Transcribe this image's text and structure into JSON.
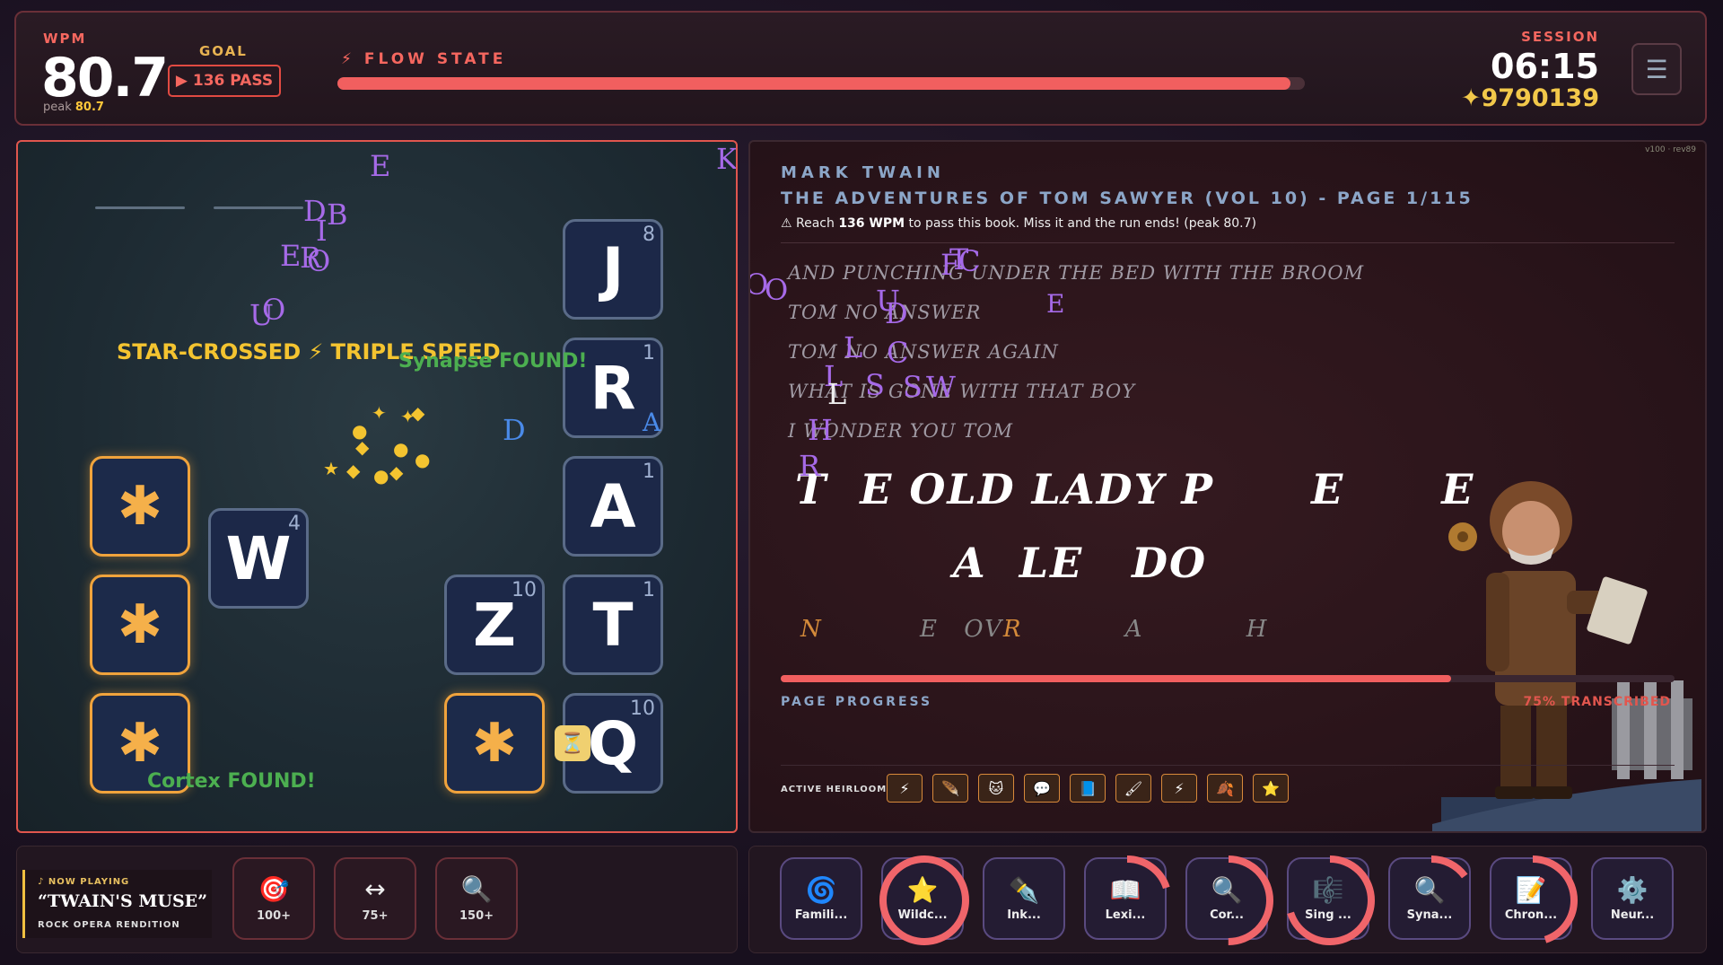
{
  "hud": {
    "wpm_label": "WPM",
    "wpm_value": "80.7",
    "peak_label": "peak",
    "peak_value": "80.7",
    "goal_label": "GOAL",
    "goal_button": "▶ 136 PASS",
    "flow_label": "⚡ FLOW STATE",
    "flow_progress": 0.985,
    "session_label": "SESSION",
    "session_time": "06:15",
    "score": "✦9790139",
    "menu_icon": "hamburger-menu-icon"
  },
  "board": {
    "tiles": [
      {
        "letter": "J",
        "score": "8",
        "gold": false
      },
      {
        "letter": "R",
        "score": "1",
        "gold": false
      },
      {
        "letter": "A",
        "score": "1",
        "gold": false
      },
      {
        "letter": "W",
        "score": "4",
        "gold": false
      },
      {
        "letter": "Z",
        "score": "10",
        "gold": false
      },
      {
        "letter": "T",
        "score": "1",
        "gold": false
      },
      {
        "letter": "Q",
        "score": "10",
        "gold": false
      },
      {
        "letter": "✱",
        "score": "",
        "gold": true
      },
      {
        "letter": "✱",
        "score": "",
        "gold": true
      },
      {
        "letter": "✱",
        "score": "",
        "gold": true
      },
      {
        "letter": "✱",
        "score": "",
        "gold": true
      }
    ],
    "combo_text": "STAR-CROSSED ⚡ TRIPLE SPEED",
    "found_1": "Synapse FOUND!",
    "found_2": "Cortex FOUND!",
    "floating_letters": [
      "E",
      "K",
      "D",
      "B",
      "I",
      "E",
      "R",
      "O",
      "U",
      "O",
      "D",
      "A"
    ]
  },
  "book": {
    "version": "v100 · rev89",
    "author": "MARK TWAIN",
    "title": "THE ADVENTURES OF TOM SAWYER (VOL 10) - PAGE 1/115",
    "warning_pre": "⚠ Reach ",
    "warning_wpm": "136 WPM",
    "warning_post": " to pass this book. Miss it and the run ends! (peak 80.7)",
    "lines": [
      "AND PUNCHING UNDER THE BED WITH THE BROOM",
      "TOM NO ANSWER",
      "TOM NO ANSWER AGAIN",
      "WHAT IS GONE WITH THAT BOY",
      "I WONDER YOU TOM"
    ],
    "current_line_1": "T  E OLD LADY P      E      E",
    "current_line_2": "A  LE   DO",
    "next_line_parts": [
      "N",
      "E",
      "OV",
      "R",
      "A",
      "H"
    ],
    "floating_letters": [
      "O",
      "O",
      "F",
      "T",
      "C",
      "U",
      "D",
      "E",
      "L",
      "C",
      "L",
      "L",
      "S",
      "S",
      "W",
      "H",
      "R"
    ],
    "page_progress_label": "PAGE PROGRESS",
    "page_progress": 0.75,
    "page_progress_text": "75% TRANSCRIBED",
    "heirlooms_label": "ACTIVE HEIRLOOMS:",
    "heirlooms": [
      "⚡",
      "🪶",
      "🐱",
      "💬",
      "📘",
      "🖌",
      "⚡",
      "🍂",
      "⭐"
    ]
  },
  "now_playing": {
    "label": "♪ NOW PLAYING",
    "title": "“TWAIN'S MUSE”",
    "subtitle": "ROCK OPERA RENDITION"
  },
  "powerups": [
    {
      "icon": "🎯",
      "label": "100+"
    },
    {
      "icon": "↔",
      "label": "75+"
    },
    {
      "icon": "🔍",
      "label": "150+"
    }
  ],
  "abilities": [
    {
      "icon": "🌀",
      "label": "Famili...",
      "cooldown": 0
    },
    {
      "icon": "⭐",
      "label": "Wildc...",
      "cooldown": 1.0
    },
    {
      "icon": "✒️",
      "label": "Ink...",
      "cooldown": 0
    },
    {
      "icon": "📖",
      "label": "Lexi...",
      "cooldown": 0.2
    },
    {
      "icon": "🔍",
      "label": "Cor...",
      "cooldown": 0.5
    },
    {
      "icon": "🎼",
      "label": "Sing ...",
      "cooldown": 0.7
    },
    {
      "icon": "🔍",
      "label": "Syna...",
      "cooldown": 0.15
    },
    {
      "icon": "📝",
      "label": "Chron...",
      "cooldown": 0.45
    },
    {
      "icon": "⚙️",
      "label": "Neur...",
      "cooldown": 0
    }
  ]
}
